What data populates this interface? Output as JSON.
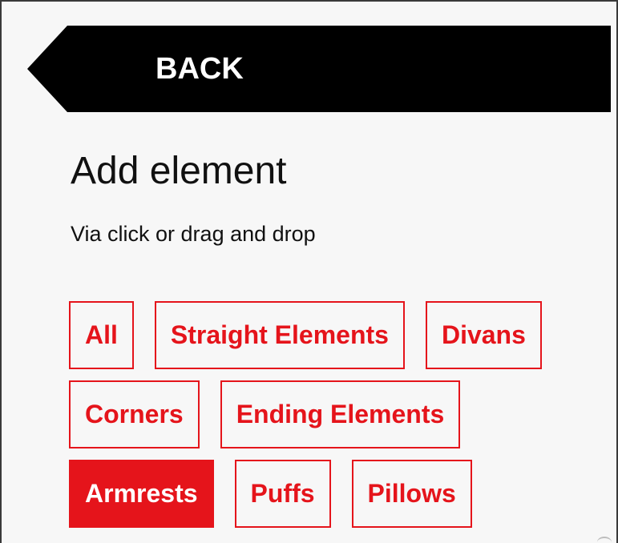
{
  "back": {
    "label": "BACK"
  },
  "panel": {
    "title": "Add element",
    "subtitle": "Via click or drag and drop"
  },
  "filters": {
    "rows": [
      [
        {
          "label": "All",
          "active": false
        },
        {
          "label": "Straight Elements",
          "active": false
        },
        {
          "label": "Divans",
          "active": false
        }
      ],
      [
        {
          "label": "Corners",
          "active": false
        },
        {
          "label": "Ending Elements",
          "active": false
        }
      ],
      [
        {
          "label": "Armrests",
          "active": true
        },
        {
          "label": "Puffs",
          "active": false
        },
        {
          "label": "Pillows",
          "active": false
        }
      ]
    ]
  },
  "colors": {
    "accent": "#e5141b",
    "back_bg": "#000000",
    "panel_bg": "#f7f7f7"
  }
}
